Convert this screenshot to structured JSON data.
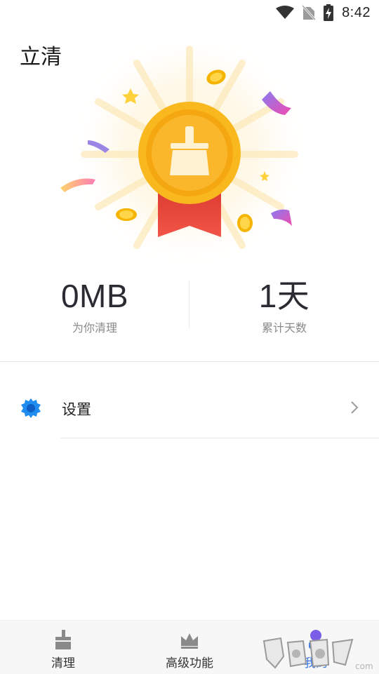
{
  "status_bar": {
    "time": "8:42",
    "icons": [
      "wifi-icon",
      "no-sim-icon",
      "battery-charging-icon"
    ]
  },
  "app": {
    "title": "立清"
  },
  "illustration": {
    "icon": "medal-broom-icon",
    "colors": {
      "medal": "#f6b51c",
      "ribbon": "#f04a3e",
      "broom": "#fff1cf"
    }
  },
  "stats": {
    "cleaned": {
      "value": "0MB",
      "label": "为你清理"
    },
    "days": {
      "value": "1天",
      "label": "累计天数"
    }
  },
  "settings": {
    "icon": "gear-icon",
    "label": "设置",
    "chevron": "chevron-right-icon",
    "icon_color": "#1e8cf0"
  },
  "bottom_nav": {
    "items": [
      {
        "label": "清理",
        "icon": "broom-icon"
      },
      {
        "label": "高级功能",
        "icon": "crown-icon"
      },
      {
        "label": "我的",
        "icon": "person-icon",
        "active": true
      }
    ],
    "active_color": "#3a78e6"
  },
  "watermark": {
    "icon": "watermark-logo"
  }
}
